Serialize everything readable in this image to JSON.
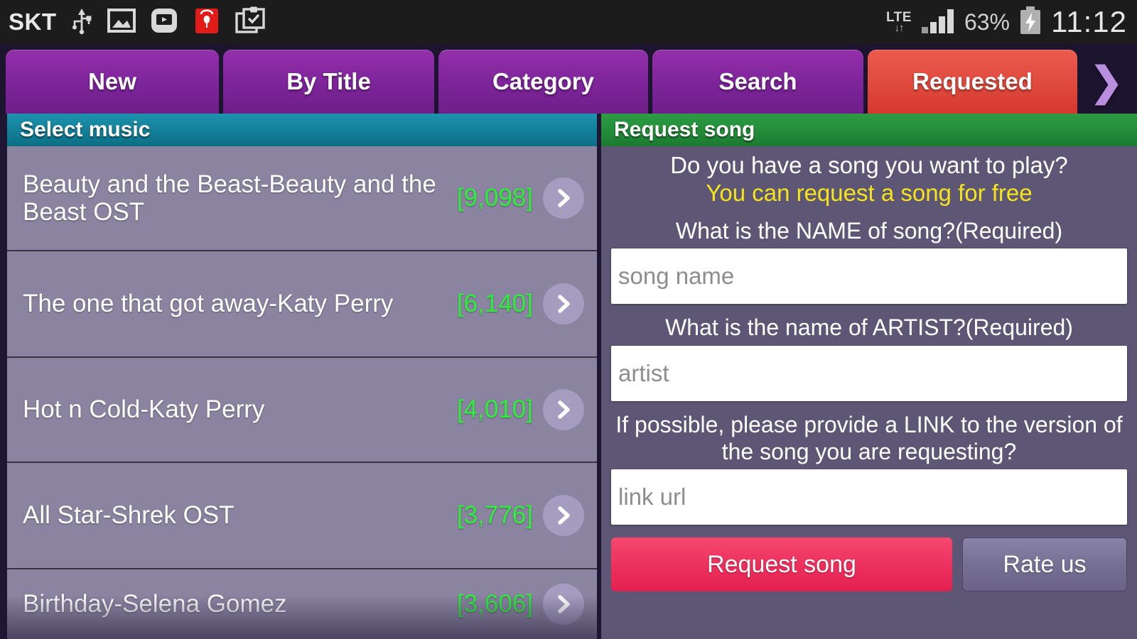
{
  "status_bar": {
    "carrier": "SKT",
    "icons": [
      "usb-icon",
      "screenshot-image-icon",
      "media-player-icon",
      "red-shopping-bag-icon",
      "clipboard-check-icon"
    ],
    "network_type": "LTE",
    "network_arrows": "↓↑",
    "signal": "signal-bars-icon",
    "battery_percent": "63%",
    "battery_state": "battery-charging-icon",
    "clock": "11:12"
  },
  "tabs": {
    "items": [
      {
        "label": "New",
        "active": false
      },
      {
        "label": "By Title",
        "active": false
      },
      {
        "label": "Category",
        "active": false
      },
      {
        "label": "Search",
        "active": false
      },
      {
        "label": "Requested",
        "active": true
      }
    ],
    "overflow_icon": "❯",
    "active_color": "#e04a3d",
    "inactive_color": "#8429a0"
  },
  "left_panel": {
    "header": "Select music",
    "header_color": "#137f98",
    "count_color": "#2cf03a",
    "songs": [
      {
        "title": "Beauty and the Beast-Beauty and the Beast OST",
        "count": "[9,098]"
      },
      {
        "title": "The one that got away-Katy Perry",
        "count": "[6,140]"
      },
      {
        "title": "Hot n Cold-Katy Perry",
        "count": "[4,010]"
      },
      {
        "title": "All Star-Shrek OST",
        "count": "[3,776]"
      },
      {
        "title": "Birthday-Selena Gomez",
        "count": "[3,606]"
      }
    ]
  },
  "right_panel": {
    "header": "Request song",
    "header_color": "#23893a",
    "lead_line1": "Do you have a song you want to play?",
    "lead_line2": "You can request a song for free",
    "lead_line2_color": "#f5e41a",
    "fields": [
      {
        "label": "What is the NAME of song?(Required)",
        "placeholder": "song name",
        "value": ""
      },
      {
        "label": "What is the name of ARTIST?(Required)",
        "placeholder": "artist",
        "value": ""
      },
      {
        "label": "If possible, please provide a LINK to the version of the song you are requesting?",
        "placeholder": "link url",
        "value": ""
      }
    ],
    "request_button": "Request song",
    "request_button_color": "#ec2f5c",
    "rate_button": "Rate us"
  }
}
